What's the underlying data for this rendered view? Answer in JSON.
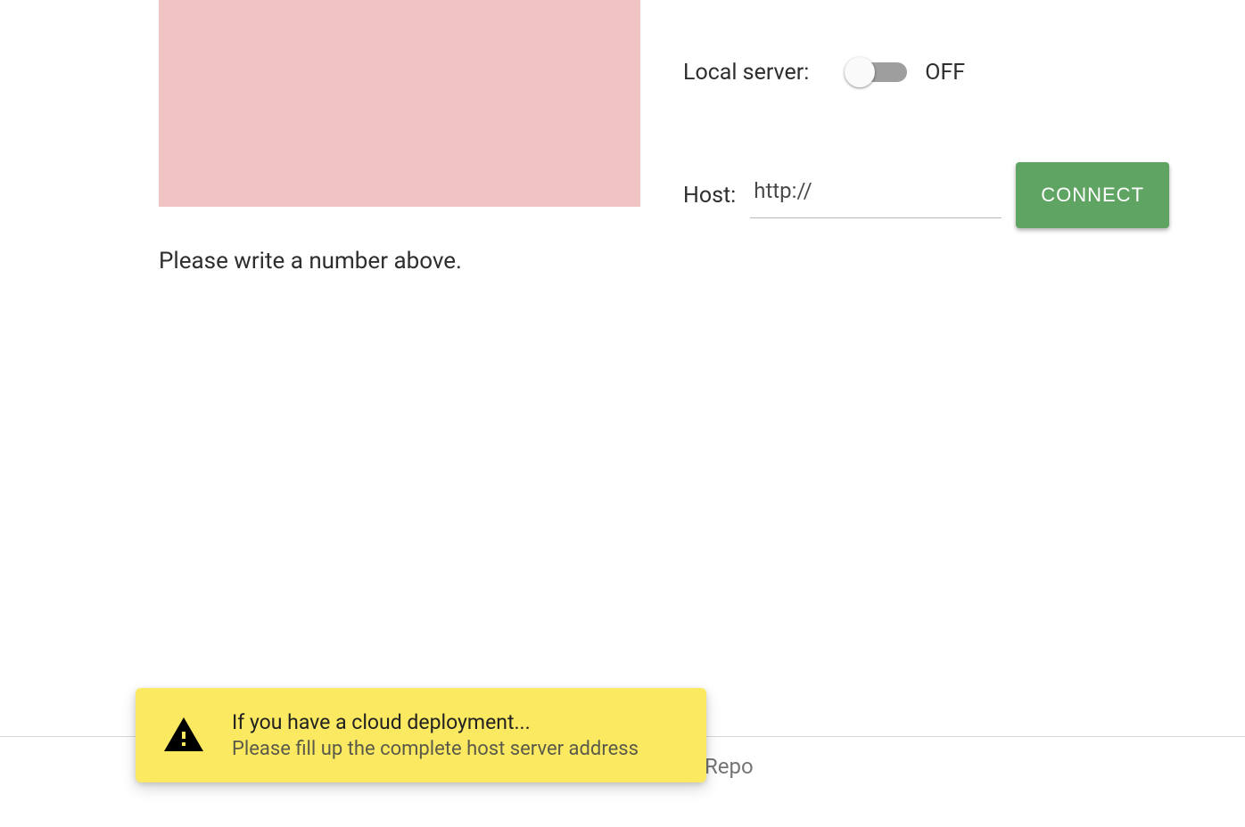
{
  "left": {
    "instruction": "Please write a number above."
  },
  "controls": {
    "local_server_label": "Local server:",
    "toggle_state": "OFF",
    "host_label": "Host:",
    "host_value": "http://",
    "connect_label": "CONNECT"
  },
  "footer": {
    "repo_text": "Repo"
  },
  "notification": {
    "title": "If you have a cloud deployment...",
    "body": "Please fill up the complete host server address"
  }
}
